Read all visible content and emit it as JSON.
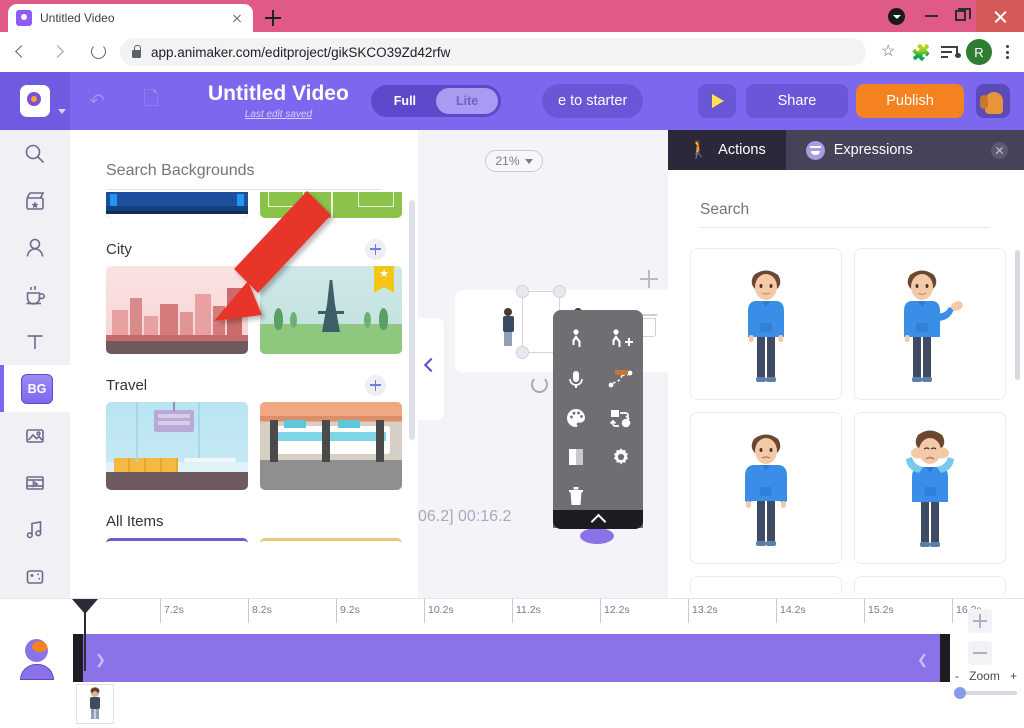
{
  "browser": {
    "tab_title": "Untitled Video",
    "url": "app.animaker.com/editproject/gikSKCO39Zd42rfw",
    "profile_initial": "R",
    "icons": {
      "back": "back-arrow-icon",
      "forward": "forward-arrow-icon",
      "reload": "reload-icon",
      "lock": "lock-icon",
      "star": "star-icon",
      "extensions": "puzzle-icon",
      "media": "media-list-icon",
      "menu": "kebab-menu-icon"
    }
  },
  "header": {
    "project_title": "Untitled Video",
    "save_status": "Last edit saved",
    "mode_full": "Full",
    "mode_lite": "Lite",
    "upgrade_label": "e to starter",
    "share_label": "Share",
    "publish_label": "Publish"
  },
  "rail": {
    "items": [
      {
        "name": "search",
        "label": "Search"
      },
      {
        "name": "scenes",
        "label": "Scenes"
      },
      {
        "name": "characters",
        "label": "Characters"
      },
      {
        "name": "props",
        "label": "Props"
      },
      {
        "name": "text",
        "label": "Text"
      },
      {
        "name": "bg",
        "label": "BG"
      },
      {
        "name": "images",
        "label": "Images"
      },
      {
        "name": "video",
        "label": "Video"
      },
      {
        "name": "music",
        "label": "Music"
      },
      {
        "name": "effects",
        "label": "Effects"
      }
    ],
    "active": "bg"
  },
  "backgrounds": {
    "search_placeholder": "Search Backgrounds",
    "sections": [
      {
        "title": "",
        "items": [
          "stadium-seats-thumb",
          "football-field-thumb"
        ]
      },
      {
        "title": "City",
        "items": [
          "city-skyline-thumb",
          "eiffel-tower-thumb"
        ]
      },
      {
        "title": "Travel",
        "items": [
          "airport-lounge-thumb",
          "train-station-thumb"
        ]
      },
      {
        "title": "All Items",
        "items": [
          "all-item-1-thumb",
          "all-item-2-thumb"
        ]
      }
    ],
    "bookmark_badge": "★"
  },
  "canvas": {
    "zoom_level": "21%",
    "timecode": "06.2]  00:16.2"
  },
  "context_menu": {
    "items": [
      "action-icon",
      "add-action-icon",
      "microphone-icon",
      "motion-path-icon",
      "color-palette-icon",
      "swap-icon",
      "contrast-icon",
      "settings-gear-icon",
      "delete-trash-icon"
    ]
  },
  "right_panel": {
    "tabs": [
      {
        "label": "Actions",
        "icon": "walking-person-icon",
        "active": true
      },
      {
        "label": "Expressions",
        "icon": "smiley-face-icon",
        "active": false
      }
    ],
    "search_placeholder": "Search",
    "actions": [
      {
        "name": "stand-idle-action"
      },
      {
        "name": "presenting-action"
      },
      {
        "name": "stand-arms-down-action"
      },
      {
        "name": "hands-on-head-action"
      }
    ]
  },
  "timeline": {
    "ticks": [
      "7.2s",
      "8.2s",
      "9.2s",
      "10.2s",
      "11.2s",
      "12.2s",
      "13.2s",
      "14.2s",
      "15.2s",
      "16.2s"
    ],
    "zoom_label": "Zoom",
    "zoom_minus": "-",
    "zoom_plus": "+"
  }
}
